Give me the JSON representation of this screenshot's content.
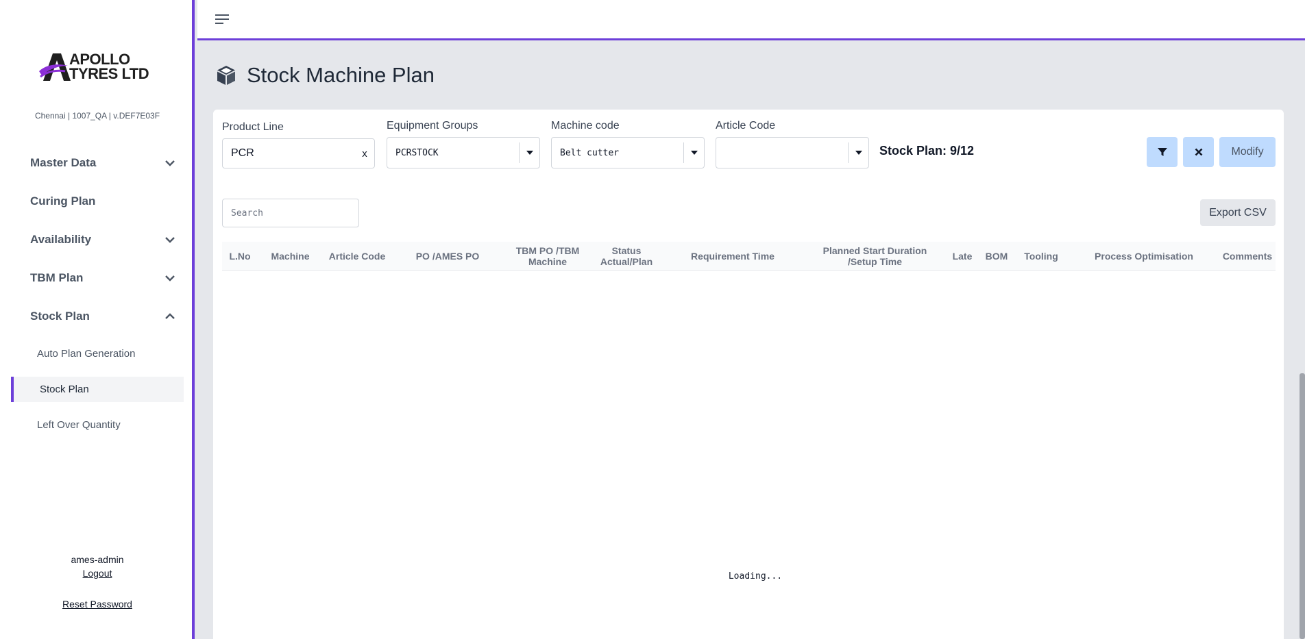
{
  "brand": {
    "line1": "APOLLO",
    "line2": "TYRES LTD",
    "accent": "#6d3fd9"
  },
  "env_info": "Chennai | 1007_QA | v.DEF7E03F",
  "nav": {
    "master_data": "Master Data",
    "curing_plan": "Curing Plan",
    "availability": "Availability",
    "tbm_plan": "TBM Plan",
    "stock_plan": "Stock Plan",
    "sub_auto_plan": "Auto Plan Generation",
    "sub_stock_plan": "Stock Plan",
    "sub_left_over": "Left Over Quantity"
  },
  "user": {
    "name": "ames-admin",
    "logout": "Logout",
    "reset_password": "Reset Password"
  },
  "page": {
    "title": "Stock Machine Plan",
    "icon": "cube-icon"
  },
  "filters": {
    "product_line_label": "Product Line",
    "product_line_value": "PCR",
    "clear_label": "x",
    "equipment_groups_label": "Equipment Groups",
    "equipment_groups_value": "PCRSTOCK",
    "machine_code_label": "Machine code",
    "machine_code_value": "Belt cutter",
    "article_code_label": "Article Code",
    "article_code_value": ""
  },
  "stock_plan_count": "Stock Plan: 9/12",
  "buttons": {
    "modify": "Modify",
    "export_csv": "Export CSV"
  },
  "search": {
    "placeholder": "Search"
  },
  "table": {
    "columns": {
      "lno": "L.No",
      "machine": "Machine",
      "article_code": "Article Code",
      "po_ames_po": "PO /AMES PO",
      "tbm_po_1": "TBM PO /TBM",
      "tbm_po_2": "Machine",
      "status_1": "Status",
      "status_2": "Actual/Plan",
      "requirement_time": "Requirement Time",
      "planned_1": "Planned Start Duration",
      "planned_2": "/Setup Time",
      "late": "Late",
      "bom": "BOM",
      "tooling": "Tooling",
      "process_optimisation": "Process Optimisation",
      "comments": "Comments"
    },
    "loading_text": "Loading..."
  }
}
